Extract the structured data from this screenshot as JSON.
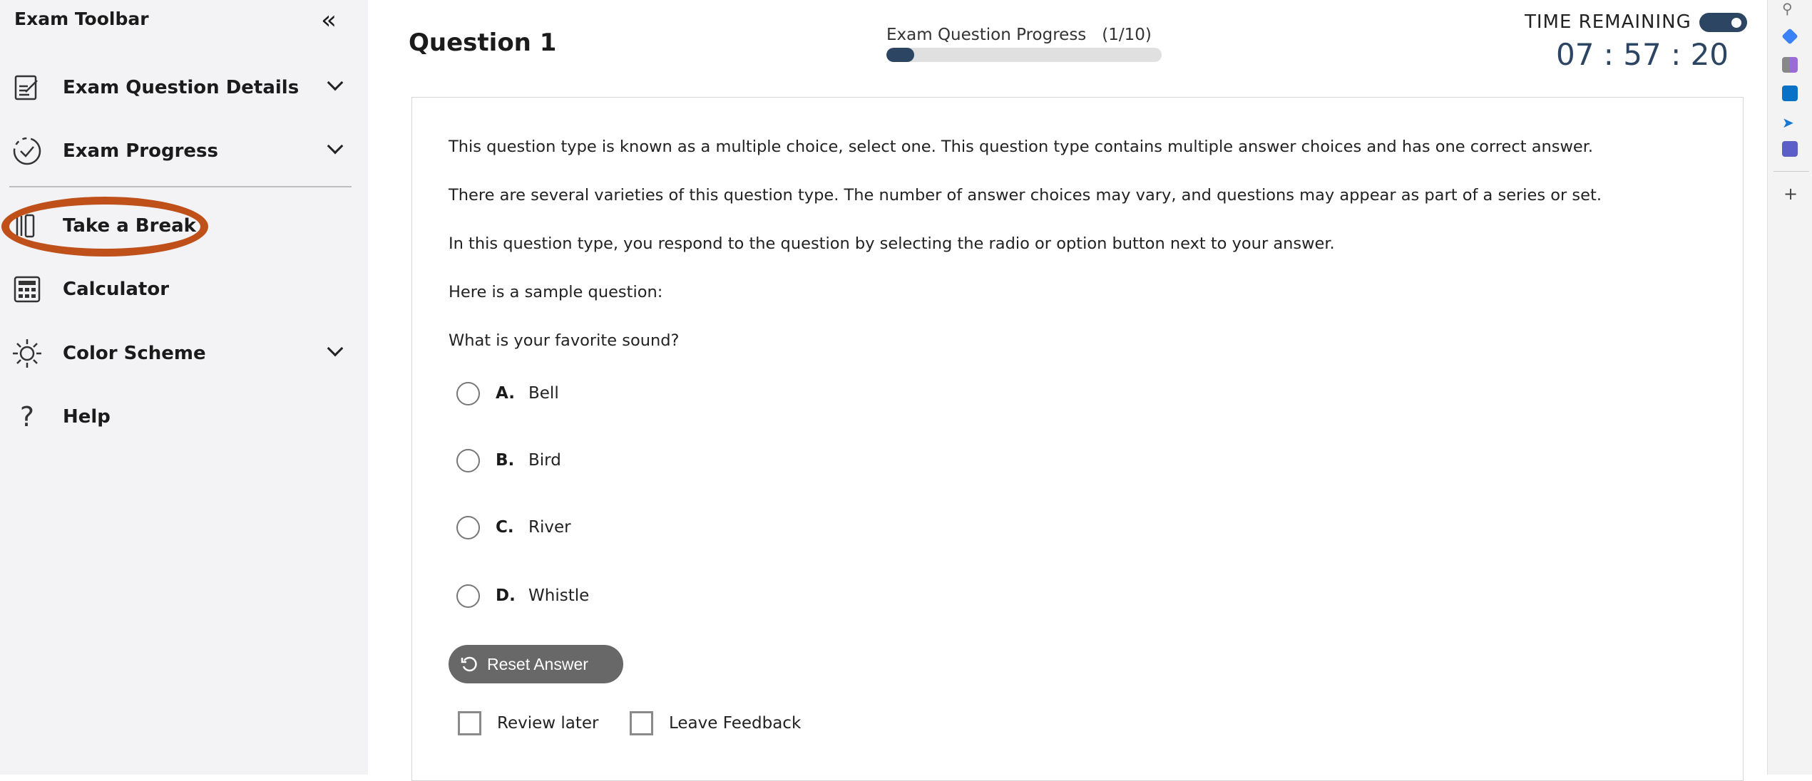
{
  "sidebar": {
    "title": "Exam Toolbar",
    "items": [
      {
        "label": "Exam Question Details",
        "icon": "edit-document-icon",
        "expandable": true
      },
      {
        "label": "Exam Progress",
        "icon": "progress-check-icon",
        "expandable": true
      },
      {
        "label": "Take a Break",
        "icon": "pause-break-icon",
        "expandable": false,
        "highlighted": true
      },
      {
        "label": "Calculator",
        "icon": "calculator-icon",
        "expandable": false
      },
      {
        "label": "Color Scheme",
        "icon": "sun-icon",
        "expandable": true
      },
      {
        "label": "Help",
        "icon": "question-icon",
        "expandable": false
      }
    ],
    "highlight_color": "#c0501a"
  },
  "header": {
    "question_title": "Question 1",
    "progress_label": "Exam Question Progress",
    "progress_count": "(1/10)",
    "progress_fraction": 0.1,
    "time_label": "TIME REMAINING",
    "timer_toggle_on": true,
    "timer": "07 : 57 : 20",
    "accent": "#2b4563"
  },
  "question": {
    "paragraphs": [
      "This question type is known as a multiple choice, select one. This question type contains multiple answer choices and has one correct answer.",
      "There are several varieties of this question type. The number of answer choices may vary, and questions may appear as part of a series or set.",
      "In this question type, you respond to the question by selecting the radio or option button next to your answer.",
      "Here is a sample question:",
      "What is your favorite sound?"
    ],
    "options": [
      {
        "letter": "A.",
        "text": "Bell"
      },
      {
        "letter": "B.",
        "text": "Bird"
      },
      {
        "letter": "C.",
        "text": "River"
      },
      {
        "letter": "D.",
        "text": "Whistle"
      }
    ],
    "reset_label": "Reset Answer",
    "review_later": "Review later",
    "leave_feedback": "Leave Feedback"
  },
  "right_strip": {
    "icons": [
      "search-icon",
      "tag-icon",
      "games-icon",
      "outlook-icon",
      "send-icon",
      "teams-icon",
      "add-icon"
    ]
  }
}
